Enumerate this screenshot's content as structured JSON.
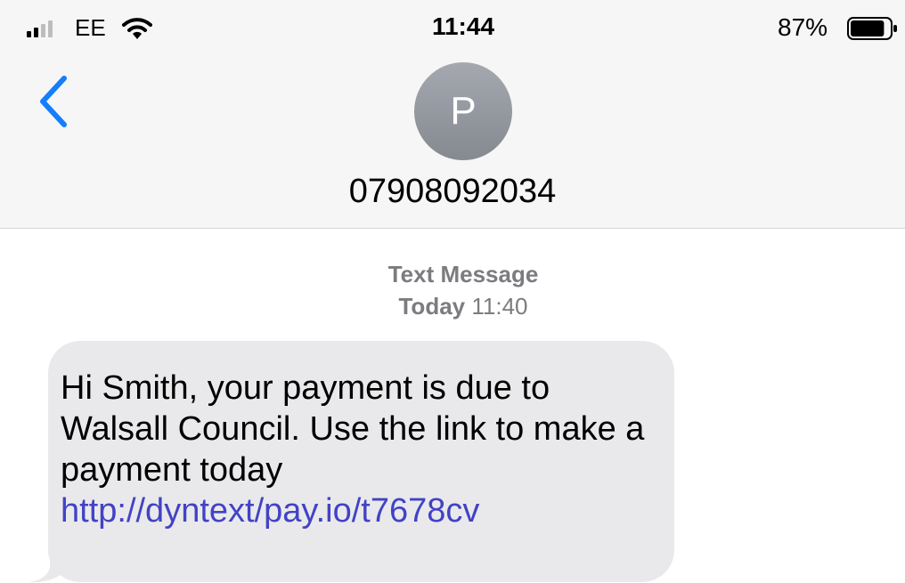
{
  "status_bar": {
    "carrier": "EE",
    "time": "11:44",
    "battery_percent": "87%",
    "battery_level": 0.87,
    "signal_bars": 2,
    "signal_icon": "cellular-signal-icon",
    "wifi_icon": "wifi-icon",
    "battery_icon": "battery-icon"
  },
  "nav": {
    "back_icon": "chevron-left-icon",
    "avatar_letter": "P",
    "contact": "07908092034"
  },
  "conversation": {
    "message_type": "Text Message",
    "day": "Today",
    "time": "11:40",
    "messages": [
      {
        "text": "Hi Smith, your payment is due to Walsall Council. Use the link to make a payment today",
        "link": "http://dyntext/pay.io/t7678cv"
      }
    ]
  },
  "colors": {
    "accent": "#147efb",
    "bubble_bg": "#e9e9eb",
    "link": "#4242c6",
    "meta_text": "#7c7c80",
    "header_bg": "#f6f6f6"
  }
}
